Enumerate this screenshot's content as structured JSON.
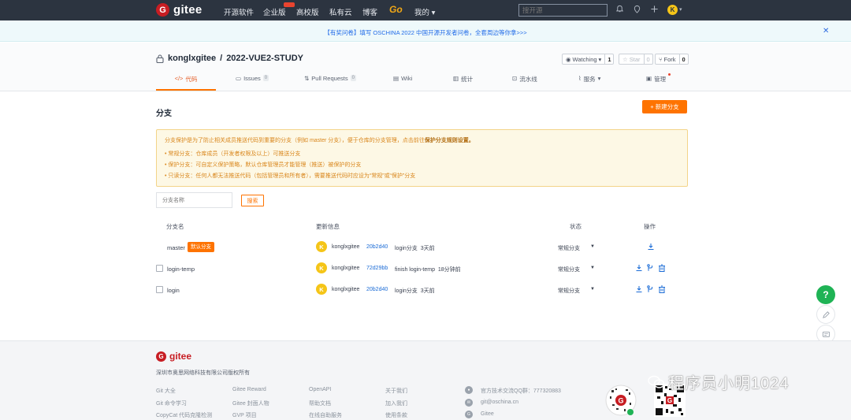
{
  "nav": {
    "logo_text": "gitee",
    "items": [
      "开源软件",
      "企业版",
      "高校版",
      "私有云",
      "博客"
    ],
    "go_label": "Go",
    "my_label": "我的",
    "search_placeholder": "搜开源",
    "avatar_letter": "K"
  },
  "banner": {
    "text": "【有奖问卷】填写 OSCHINA 2022 中国开源开发者问卷，全套周边等你拿>>>"
  },
  "repo": {
    "owner": "konglxgitee",
    "separator": "/",
    "name": "2022-VUE2-STUDY",
    "watch_label": "Watching",
    "watch_count": "1",
    "star_label": "Star",
    "star_count": "0",
    "fork_label": "Fork",
    "fork_count": "0"
  },
  "tabs": [
    {
      "label": "代码",
      "count": ""
    },
    {
      "label": "Issues",
      "count": "0"
    },
    {
      "label": "Pull Requests",
      "count": "0"
    },
    {
      "label": "Wiki",
      "count": ""
    },
    {
      "label": "统计",
      "count": ""
    },
    {
      "label": "流水线",
      "count": ""
    },
    {
      "label": "服务",
      "count": ""
    },
    {
      "label": "管理",
      "count": ""
    }
  ],
  "page": {
    "heading": "分支",
    "new_branch_label": "新建分支"
  },
  "notice": {
    "intro_prefix": "分支保护是为了防止相关成员推送代码到重要的分支（例如 master 分支），便于仓库的分支管理，点击前往",
    "intro_link": "保护分支规则设置。",
    "items": [
      "常规分支：仓库成员（开发者权限及以上）可推送分支",
      "保护分支：可自定义保护策略，默认仓库管理员才能管理（推送）被保护的分支",
      "只读分支：任何人都无法推送代码（包括管理员和所有者），需要推送代码时应设为“常规”或“保护”分支"
    ]
  },
  "filter": {
    "placeholder": "分支名称",
    "search_label": "搜索"
  },
  "table": {
    "headers": {
      "name": "分支名",
      "update": "更新信息",
      "status": "状态",
      "action": "操作"
    },
    "default_badge": "默认分支",
    "rows": [
      {
        "name": "master",
        "is_default": true,
        "avatar": "K",
        "user": "konglxgitee",
        "sha": "20b2d40",
        "message": "login分支",
        "time": "3天前",
        "status": "常规分支"
      },
      {
        "name": "login-temp",
        "is_default": false,
        "avatar": "K",
        "user": "konglxgitee",
        "sha": "72d29bb",
        "message": "finish login-temp",
        "time": "18分钟前",
        "status": "常规分支"
      },
      {
        "name": "login",
        "is_default": false,
        "avatar": "K",
        "user": "konglxgitee",
        "sha": "20b2d40",
        "message": "login分支",
        "time": "3天前",
        "status": "常规分支"
      }
    ]
  },
  "side": {
    "help_label": "?"
  },
  "footer": {
    "logo_text": "gitee",
    "copyright": "深圳市奥思网络科技有限公司版权所有",
    "col1": [
      "Git 大全",
      "Git 命令学习",
      "CopyCat 代码克隆检测"
    ],
    "col2": [
      "Gitee Reward",
      "Gitee 封面人物",
      "GVP 项目"
    ],
    "col3": [
      "OpenAPI",
      "帮助文档",
      "在线自助服务"
    ],
    "col4": [
      "关于我们",
      "加入我们",
      "使用条款"
    ],
    "contacts": [
      "官方技术交流QQ群：777320883",
      "git@oschina.cn",
      "Gitee"
    ],
    "watermark": "程序员小明1024"
  },
  "colors": {
    "accent": "#fe7300",
    "nav_bg": "#2c3440",
    "link": "#1a6bd6",
    "help_green": "#1fb355"
  }
}
